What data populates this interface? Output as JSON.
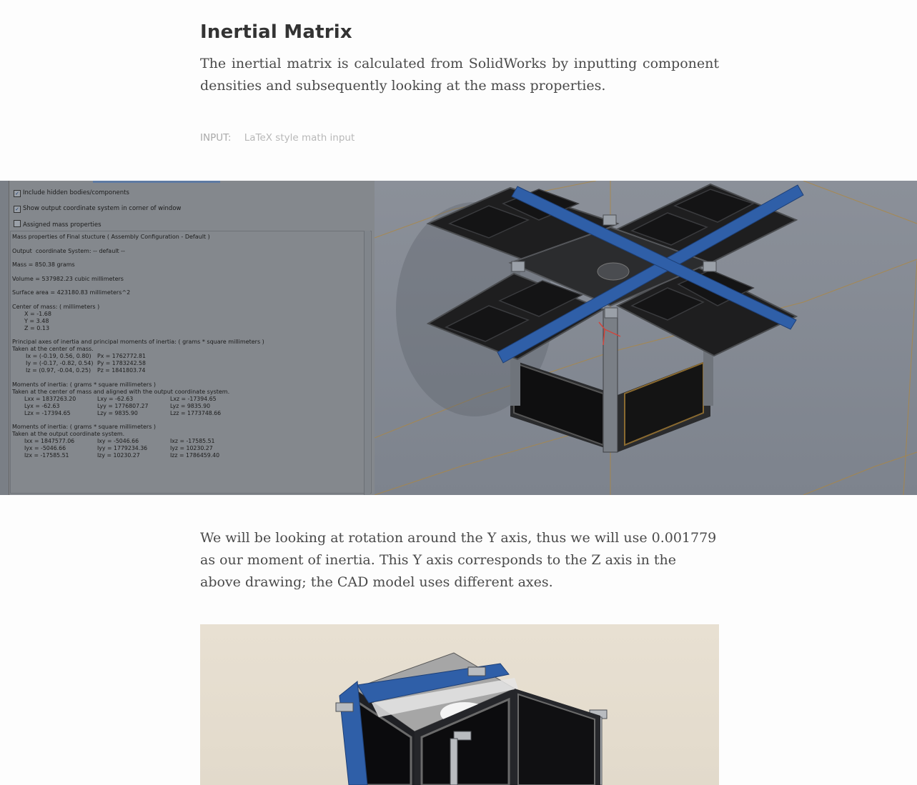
{
  "section_title": "Inertial Matrix",
  "intro_text": "The inertial matrix is calculated from SolidWorks by inputting component densities and subsequently looking at the mass properties.",
  "math_input": {
    "label": "INPUT:",
    "placeholder": "LaTeX style math input"
  },
  "mass_properties": {
    "checkboxes": [
      {
        "label": "Include hidden bodies/components",
        "checked": true
      },
      {
        "label": "Show output coordinate system in corner of window",
        "checked": true
      },
      {
        "label": "Assigned mass properties",
        "checked": false
      }
    ],
    "header": "Mass properties of Final stucture ( Assembly Configuration - Default )",
    "coord_system": "Output  coordinate System: -- default --",
    "mass": "Mass = 850.38 grams",
    "volume": "Volume = 537982.23 cubic millimeters",
    "surface_area": "Surface area = 423180.83 millimeters^2",
    "com_title": "Center of mass: ( millimeters )",
    "com_x": "X = -1.68",
    "com_y": "Y = 3.48",
    "com_z": "Z = 0.13",
    "principal_title": "Principal axes of inertia and principal moments of inertia: ( grams * square millimeters )",
    "principal_sub": "Taken at the center of mass.",
    "ix": "Ix = (-0.19, 0.56, 0.80)",
    "iy": "Iy = (-0.17, -0.82, 0.54)",
    "iz": "Iz = (0.97, -0.04, 0.25)",
    "px": "Px = 1762772.81",
    "py": "Py = 1783242.58",
    "pz": "Pz = 1841803.74",
    "moi_com_title": "Moments of inertia: ( grams * square millimeters )",
    "moi_com_sub": "Taken at the center of mass and aligned with the output coordinate system.",
    "lxx": "Lxx = 1837263.20",
    "lxy": "Lxy = -62.63",
    "lxz": "Lxz = -17394.65",
    "lyx": "Lyx = -62.63",
    "lyy": "Lyy = 1776807.27",
    "lyz": "Lyz = 9835.90",
    "lzx": "Lzx = -17394.65",
    "lzy": "Lzy = 9835.90",
    "lzz": "Lzz = 1773748.66",
    "moi_out_title": "Moments of inertia: ( grams * square millimeters )",
    "moi_out_sub": "Taken at the output coordinate system.",
    "ixx": "Ixx = 1847577.06",
    "ixy": "Ixy = -5046.66",
    "ixz": "Ixz = -17585.51",
    "iyx": "Iyx = -5046.66",
    "iyy": "Iyy = 1779234.36",
    "iyz": "Iyz = 10230.27",
    "izx": "Izx = -17585.51",
    "izy": "Izy = 10230.27",
    "izz": "Izz = 1786459.40"
  },
  "rotation_text": "We will be looking at rotation around the Y axis, thus we will use 0.001779 as our moment of inertia. This Y axis corresponds to the Z axis in the above drawing; the CAD model uses different axes.",
  "colors": {
    "panel_blue": "#2f5fa8",
    "solar_cell": "#1b1b1b",
    "frame": "#6b6f75"
  }
}
